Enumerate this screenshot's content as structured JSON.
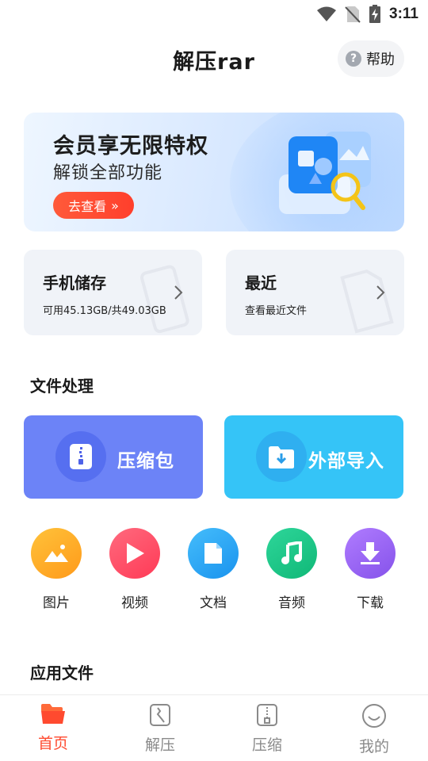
{
  "status": {
    "time": "3:11"
  },
  "header": {
    "title": "解压rar",
    "help_label": "帮助"
  },
  "banner": {
    "title": "会员享无限特权",
    "subtitle": "解锁全部功能",
    "button_label": "去查看"
  },
  "cards": {
    "storage": {
      "title": "手机储存",
      "subtitle": "可用45.13GB/共49.03GB"
    },
    "recent": {
      "title": "最近",
      "subtitle": "查看最近文件"
    }
  },
  "sections": {
    "file_processing": "文件处理",
    "app_files": "应用文件"
  },
  "actions": {
    "compress_label": "压缩包",
    "import_label": "外部导入"
  },
  "categories": [
    {
      "label": "图片",
      "icon": "image-icon",
      "color": "#ffb020"
    },
    {
      "label": "视频",
      "icon": "play-icon",
      "color": "#ff4d6a"
    },
    {
      "label": "文档",
      "icon": "document-icon",
      "color": "#2ba8f5"
    },
    {
      "label": "音频",
      "icon": "music-icon",
      "color": "#1fc98a"
    },
    {
      "label": "下载",
      "icon": "download-icon",
      "color": "#9b6bf3"
    }
  ],
  "nav": [
    {
      "label": "首页",
      "active": true
    },
    {
      "label": "解压",
      "active": false
    },
    {
      "label": "压缩",
      "active": false
    },
    {
      "label": "我的",
      "active": false
    }
  ],
  "colors": {
    "accent": "#ff4a2f",
    "compress_tile": "#6c83f7",
    "import_tile": "#35c4f7"
  }
}
